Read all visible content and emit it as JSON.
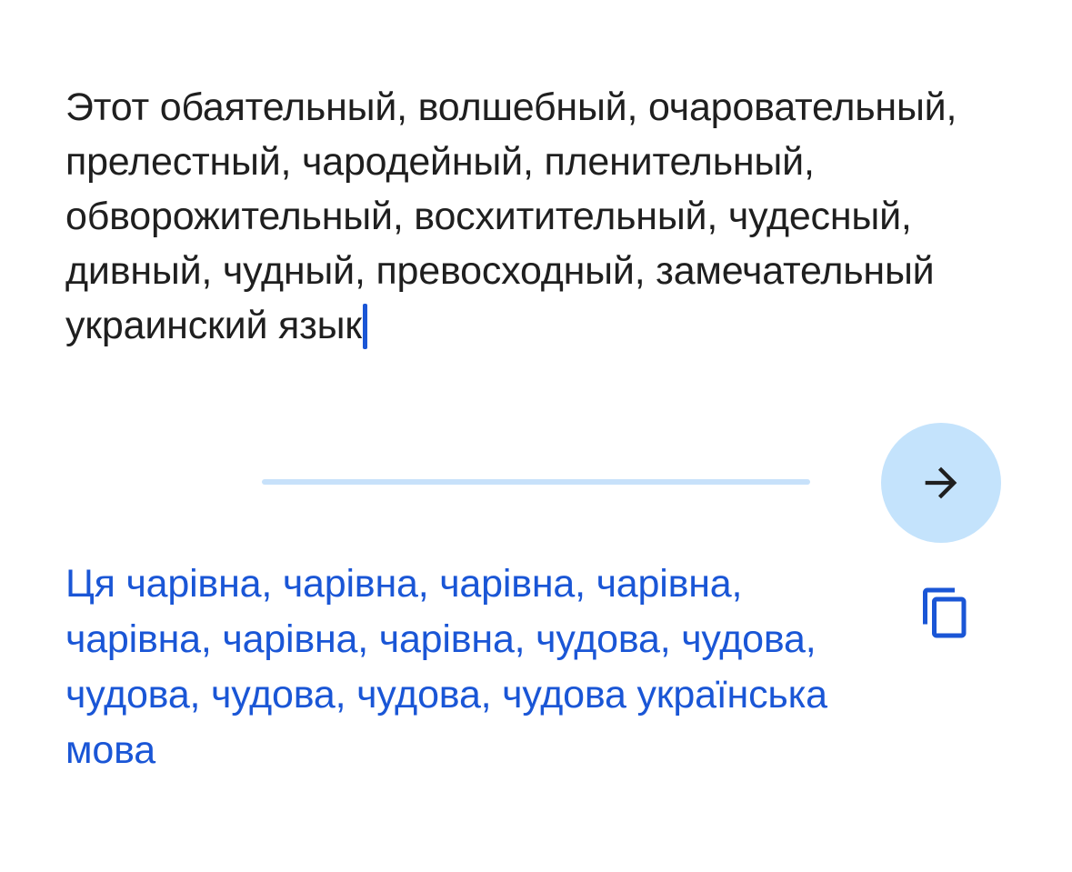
{
  "source": {
    "text": "Этот обаятельный, волшебный, очаровательный, прелестный, чародейный, пленительный, обворожительный, восхитительный, чудесный, дивный, чудный, превосходный, замечательный украинский язык"
  },
  "actions": {
    "translate_icon": "arrow-right-icon",
    "copy_icon": "copy-icon"
  },
  "result": {
    "text": "Ця чарівна, чарівна, чарівна, чарівна, чарівна, чарівна, чарівна, чудова, чудова, чудова, чудова, чудова, чудова українська мова"
  },
  "colors": {
    "text_primary": "#1f1f1f",
    "accent_blue": "#1a56d6",
    "button_bg": "#c4e3fc",
    "divider": "#c7e1fa",
    "background": "#ffffff"
  }
}
